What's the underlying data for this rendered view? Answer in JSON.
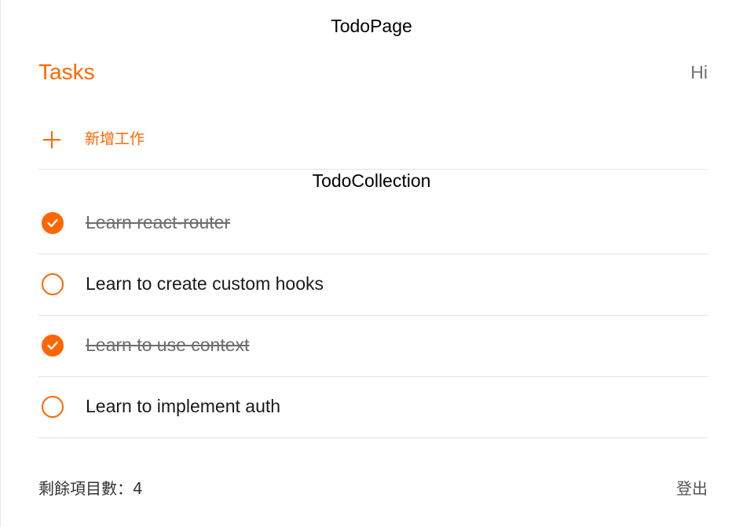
{
  "page": {
    "title": "TodoPage"
  },
  "header": {
    "brand": "Tasks",
    "greeting": "Hi"
  },
  "add_todo": {
    "placeholder": "新增工作",
    "icon": "plus-icon"
  },
  "collection": {
    "title": "TodoCollection"
  },
  "todos": [
    {
      "text": "Learn react-router",
      "done": true
    },
    {
      "text": "Learn to create custom hooks",
      "done": false
    },
    {
      "text": "Learn to use context",
      "done": true
    },
    {
      "text": "Learn to implement auth",
      "done": false
    }
  ],
  "footer": {
    "remaining_label": "剩餘項目數：",
    "remaining_count": "4",
    "logout_label": "登出"
  },
  "colors": {
    "accent": "#ff6600",
    "divider": "#e2e2e2",
    "done_text": "#6d6d6d"
  }
}
